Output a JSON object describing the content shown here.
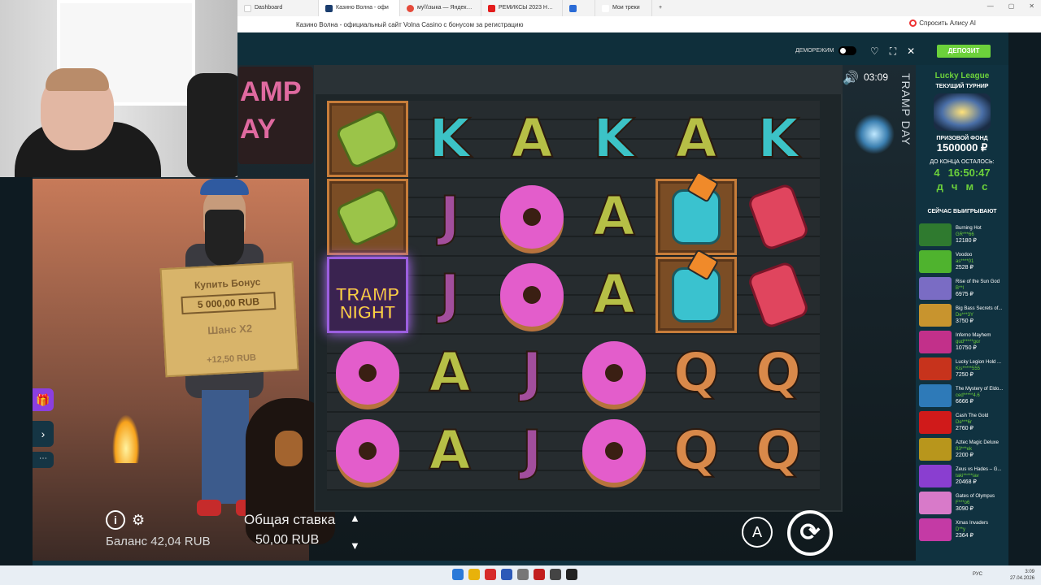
{
  "browser": {
    "tabs": [
      {
        "label": "Dashboard",
        "color": "#ffffff",
        "active": false
      },
      {
        "label": "Казино Волна - офи",
        "color": "#1a3d6e",
        "active": true
      },
      {
        "label": "му\\\\\\зыка — Яндекс: наш",
        "color": "#e54a3a",
        "active": false
      },
      {
        "label": "РЕМИКСЫ 2023 Новые р",
        "color": "#e31c1c",
        "active": false
      },
      {
        "label": "",
        "color": "#2a6bd6",
        "active": false
      },
      {
        "label": "Мои треки",
        "color": "#ffffff",
        "active": false
      }
    ],
    "new_tab": "+",
    "page_title": "Казино Волна - официальный сайт Volna Casino с бонусом за регистрацию",
    "alisa_label": "Спросить Алису AI",
    "window_controls": [
      "—",
      "▢",
      "✕"
    ]
  },
  "casino_bar": {
    "demo_label": "ДЕМОРЕЖИМ",
    "deposit_label": "ДЕПОЗИТ",
    "favorite_icon": "heart-icon",
    "fullscreen_icon": "fullscreen-icon",
    "close_icon": "close-icon"
  },
  "game": {
    "title_vertical": "TRAMP DAY",
    "sign_text": "AMP\nAY",
    "timer": "03:09",
    "buy_bonus": {
      "line1": "Купить Бонус",
      "price": "5 000,00 RUB",
      "line2": "Шанс X2",
      "line3": "+12,50 RUB"
    },
    "balance_label": "Баланс 42,04 RUB",
    "bet_label": "Общая ставка",
    "bet_value": "50,00 RUB",
    "auto_label": "A",
    "spin_icon": "⟳",
    "tramp_night_label": "TRAMP NIGHT",
    "reels": [
      [
        "cash",
        "cash",
        "tramp",
        "donut",
        "donut"
      ],
      [
        "K",
        "J",
        "J",
        "A",
        "A"
      ],
      [
        "A",
        "donut",
        "donut",
        "J",
        "J"
      ],
      [
        "K",
        "A",
        "A",
        "donut",
        "donut"
      ],
      [
        "A",
        "bottle",
        "bottle",
        "Q",
        "Q"
      ],
      [
        "K",
        "can",
        "can",
        "Q",
        "Q"
      ]
    ]
  },
  "side_menu": {
    "gift_icon": "gift-icon",
    "expand_icon": "chevron-right-icon",
    "more_icon": "dots-icon"
  },
  "tournament": {
    "title": "Lucky League",
    "subtitle": "ТЕКУЩИЙ ТУРНИР",
    "prize_label": "ПРИЗОВОЙ ФОНД",
    "prize_value": "1500000 ₽",
    "remaining_label": "ДО КОНЦА ОСТАЛОСЬ:",
    "days": "4",
    "time": "16:50:47",
    "units": [
      "д",
      "ч",
      "м",
      "с"
    ]
  },
  "winners": {
    "title": "СЕЙЧАС ВЫИГРЫВАЮТ",
    "items": [
      {
        "game": "Burning Hot",
        "user": "GR***66",
        "amount": "12180 ₽",
        "color": "#2f7a2f"
      },
      {
        "game": "Voodoo",
        "user": "as****01",
        "amount": "2528 ₽",
        "color": "#4fb32e"
      },
      {
        "game": "Rise of the Sun God",
        "user": "B**l",
        "amount": "6975 ₽",
        "color": "#7a6cc4"
      },
      {
        "game": "Big Bass Secrets of...",
        "user": "De***3Y",
        "amount": "3750 ₽",
        "color": "#c8942e"
      },
      {
        "game": "Inferno Mayhem",
        "user": "gud*****gor",
        "amount": "10750 ₽",
        "color": "#c2308a"
      },
      {
        "game": "Lucky Legion Hold ...",
        "user": "Kis*****555",
        "amount": "7250 ₽",
        "color": "#c7331c"
      },
      {
        "game": "The Mystery of Eldo...",
        "user": "ced*****4.6",
        "amount": "6666 ₽",
        "color": "#2e7ab8"
      },
      {
        "game": "Cash The Gold",
        "user": "De***6r",
        "amount": "2760 ₽",
        "color": "#d01a1a"
      },
      {
        "game": "Aztec Magic Deluxe",
        "user": "93***ek",
        "amount": "2200 ₽",
        "color": "#b8961c"
      },
      {
        "game": "Zeus vs Hades – G...",
        "user": "taki*****iav",
        "amount": "20468 ₽",
        "color": "#8a3ed0"
      },
      {
        "game": "Gates of Olympus",
        "user": "F***o6",
        "amount": "3090 ₽",
        "color": "#d87ac9"
      },
      {
        "game": "Xmas Invaders",
        "user": "D**y",
        "amount": "2364 ₽",
        "color": "#c43aa5"
      }
    ]
  },
  "taskbar": {
    "lang": "РУС",
    "time": "3:09",
    "date": "27.04.2026",
    "icons": [
      "#2a79d8",
      "#e8b20a",
      "#d62b2b",
      "#2d5ab8",
      "#777777",
      "#c21e1e",
      "#444444",
      "#222222"
    ]
  }
}
